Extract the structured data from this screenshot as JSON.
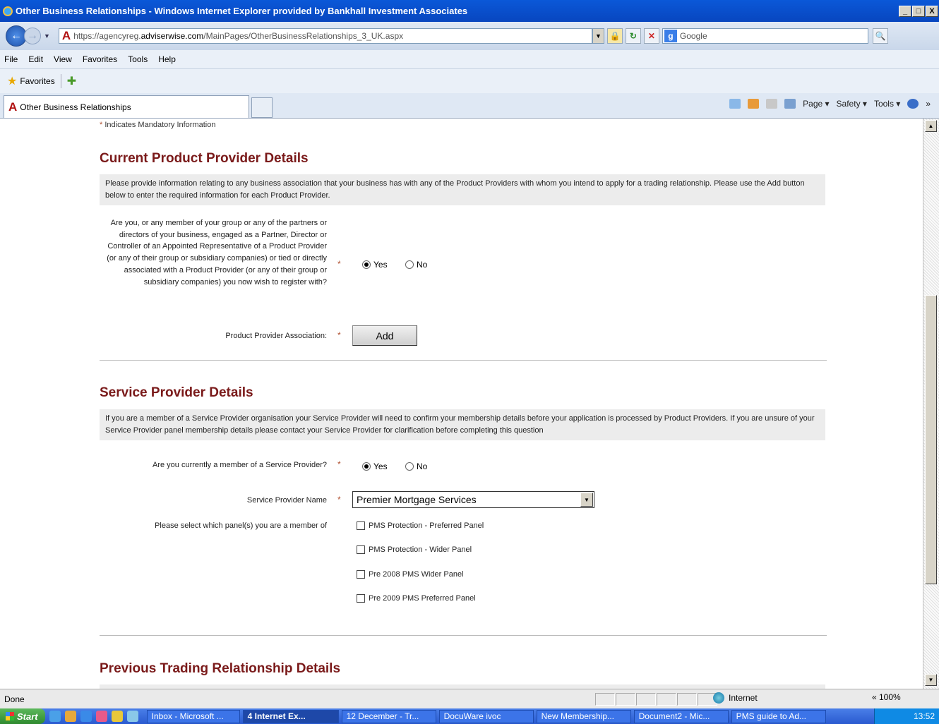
{
  "window": {
    "title": "Other Business Relationships - Windows Internet Explorer provided by Bankhall Investment Associates",
    "minimize": "_",
    "maximize": "□",
    "close": "X"
  },
  "address_bar": {
    "url_prefix": "https://agencyreg.",
    "url_host": "adviserwise.com",
    "url_path": "/MainPages/OtherBusinessRelationships_3_UK.aspx",
    "search_placeholder": "Google"
  },
  "menu": [
    "File",
    "Edit",
    "View",
    "Favorites",
    "Tools",
    "Help"
  ],
  "favorites_bar": {
    "label": "Favorites"
  },
  "tab": {
    "title": "Other Business Relationships"
  },
  "command_bar": {
    "page": "Page ▾",
    "safety": "Safety ▾",
    "tools": "Tools ▾"
  },
  "page": {
    "mandatory_note": "Indicates Mandatory Information",
    "current_product": {
      "heading": "Current Product Provider Details",
      "info": "Please provide information relating to any business association that your business has with any of the Product Providers with whom you intend to apply for a trading relationship. Please use the Add button below to enter the required information for each Product Provider.",
      "question": "Are you, or any member of your group or any of the partners or directors of your business, engaged as a Partner, Director or Controller of an Appointed Representative of a Product Provider (or any of their group or subsidiary companies) or tied or directly associated with a Product Provider (or any of their group or subsidiary companies) you now wish to register with?",
      "yes": "Yes",
      "no": "No",
      "selected": "Yes",
      "assoc_label": "Product Provider Association:",
      "add_button": "Add"
    },
    "service_provider": {
      "heading": "Service Provider Details",
      "info": "If you are a member of a Service Provider organisation your Service Provider will need to confirm your membership details before your application is processed by Product Providers. If you are unsure of your Service Provider panel membership details please contact your Service Provider for clarification before completing this question",
      "question": "Are you currently a member of a Service Provider?",
      "yes": "Yes",
      "no": "No",
      "selected": "Yes",
      "name_label": "Service Provider Name",
      "name_value": "Premier Mortgage Services",
      "panels_label": "Please select which panel(s) you are a member of",
      "panels": [
        "PMS Protection - Preferred Panel",
        "PMS Protection - Wider Panel",
        "Pre 2008 PMS Wider Panel",
        "Pre 2009 PMS Preferred Panel"
      ]
    },
    "previous": {
      "heading": "Previous Trading Relationship Details"
    }
  },
  "status_bar": {
    "status": "Done",
    "zone": "Internet",
    "zoom": "« 100%"
  },
  "taskbar": {
    "start": "Start",
    "tasks": [
      "Inbox - Microsoft ...",
      "4 Internet Ex...",
      "12 December - Tr...",
      "DocuWare ivoc",
      "New Membership...",
      "Document2 - Mic...",
      "PMS guide to Ad..."
    ],
    "clock": "13:52"
  }
}
